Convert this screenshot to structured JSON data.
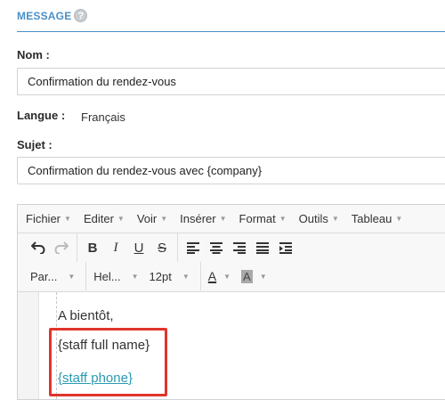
{
  "section": {
    "title": "MESSAGE",
    "help_glyph": "?"
  },
  "nom": {
    "label": "Nom :",
    "value": "Confirmation du rendez-vous"
  },
  "langue": {
    "label": "Langue :",
    "value": "Français"
  },
  "sujet": {
    "label": "Sujet :",
    "value": "Confirmation du rendez-vous avec {company}"
  },
  "editor": {
    "menu": [
      "Fichier",
      "Editer",
      "Voir",
      "Insérer",
      "Format",
      "Outils",
      "Tableau"
    ],
    "format_select": "Par...",
    "font_select": "Hel...",
    "size_select": "12pt",
    "content": {
      "line1": "A bientôt,",
      "line2": "{staff full name}",
      "line3": "{staff phone}"
    }
  },
  "colors": {
    "accent": "#4a8fc6",
    "highlight": "#e0352b",
    "link": "#2a9bb0"
  }
}
